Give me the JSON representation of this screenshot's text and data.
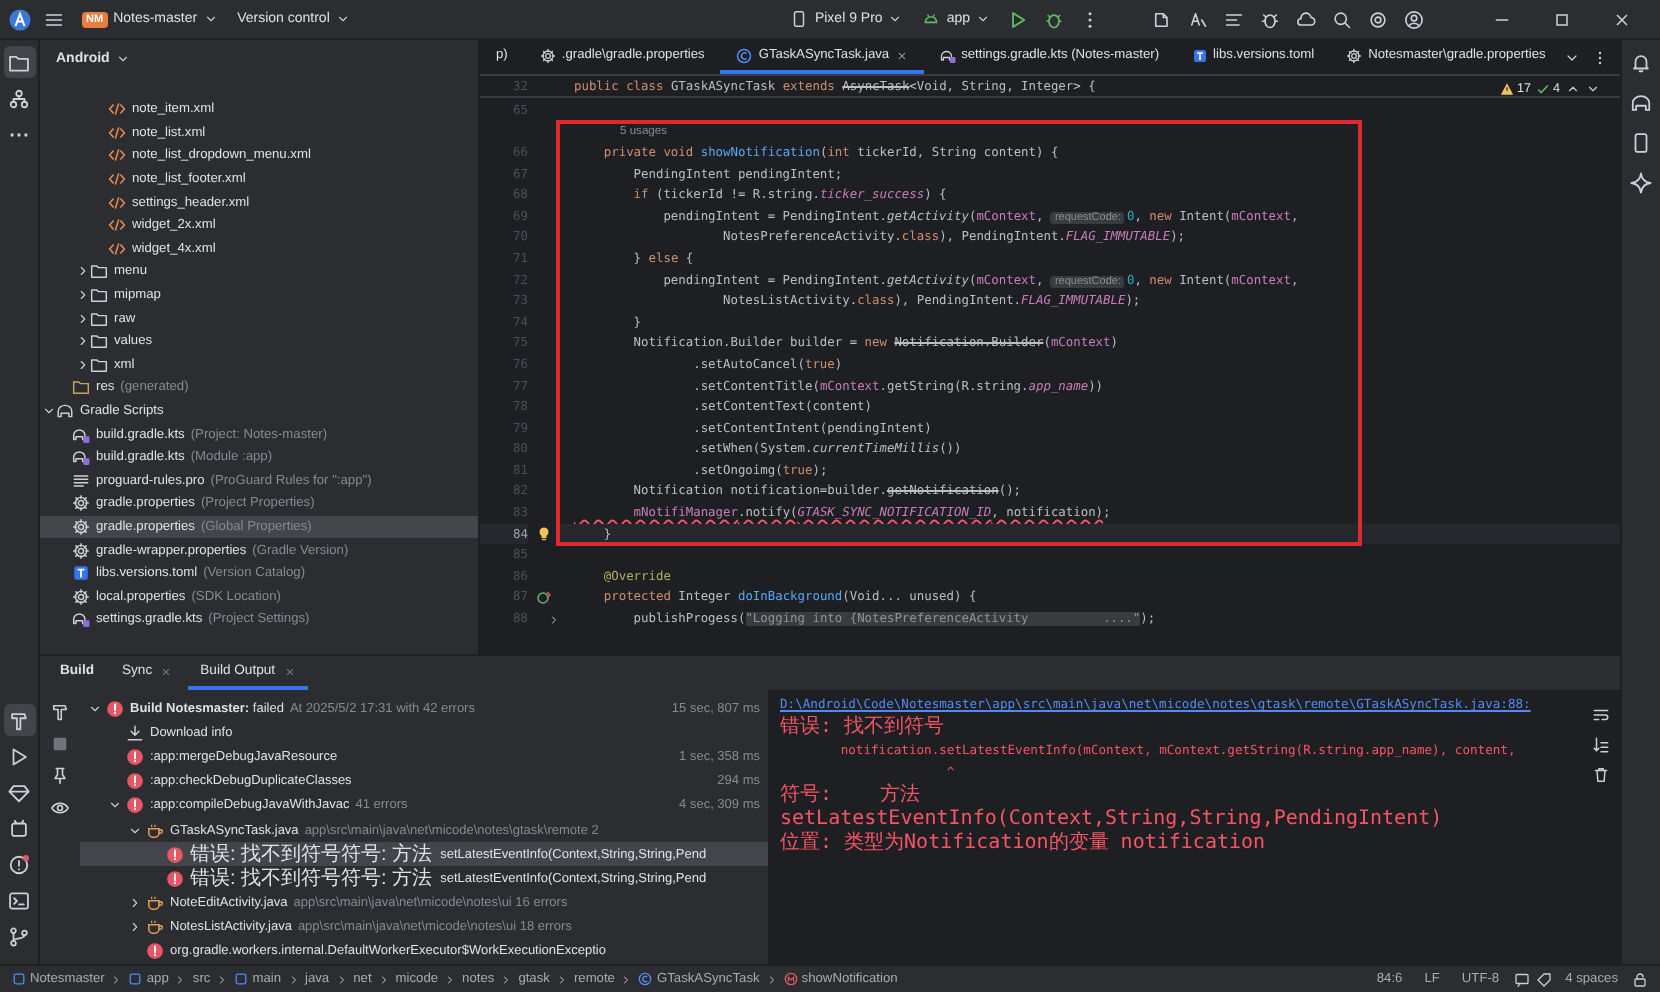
{
  "title_bar": {
    "project_badge": "NM",
    "project": "Notes-master",
    "vcs": "Version control",
    "device": "Pixel 9 Pro",
    "run_config": "app"
  },
  "tool_strip": [
    {
      "kind": "project",
      "selected": true
    },
    {
      "kind": "structure",
      "selected": false
    },
    {
      "kind": "more",
      "selected": false
    },
    {
      "kind": "build",
      "selected": true
    },
    {
      "kind": "run",
      "selected": false
    },
    {
      "kind": "gem",
      "selected": false
    },
    {
      "kind": "device",
      "selected": false
    },
    {
      "kind": "problems",
      "selected": false
    },
    {
      "kind": "terminal",
      "selected": false
    },
    {
      "kind": "git",
      "selected": false
    }
  ],
  "project_panel": {
    "view": "Android",
    "tree": [
      {
        "children": [
          {
            "children": [
              {
                "children": [
                  {
                    "label": "note_item.xml",
                    "kind": "xml",
                    "selected": false
                  },
                  {
                    "label": "note_list.xml",
                    "kind": "xml",
                    "selected": false
                  },
                  {
                    "label": "note_list_dropdown_menu.xml",
                    "kind": "xml",
                    "selected": false
                  },
                  {
                    "label": "note_list_footer.xml",
                    "kind": "xml",
                    "selected": false
                  },
                  {
                    "label": "settings_header.xml",
                    "kind": "xml",
                    "selected": false
                  },
                  {
                    "label": "widget_2x.xml",
                    "kind": "xml",
                    "selected": false
                  },
                  {
                    "label": "widget_4x.xml",
                    "kind": "xml",
                    "selected": false
                  }
                ]
              },
              {
                "label": "menu",
                "kind": "folder",
                "expanded": false,
                "selected": false
              },
              {
                "label": "mipmap",
                "kind": "folder",
                "expanded": false,
                "selected": false
              },
              {
                "label": "raw",
                "kind": "folder",
                "expanded": false,
                "selected": false
              },
              {
                "label": "values",
                "kind": "folder",
                "expanded": false,
                "selected": false
              },
              {
                "label": "xml",
                "kind": "folder",
                "expanded": false,
                "selected": false
              }
            ]
          },
          {
            "label": "res",
            "detail": "(generated)",
            "kind": "res",
            "selected": false
          }
        ]
      },
      {
        "label": "Gradle Scripts",
        "kind": "gradle_folder",
        "expanded": true,
        "selected": false,
        "children": [
          {
            "label": "build.gradle.kts",
            "detail": "(Project: Notes-master)",
            "kind": "gradle",
            "selected": false
          },
          {
            "label": "build.gradle.kts",
            "detail": "(Module :app)",
            "kind": "gradle",
            "selected": false
          },
          {
            "label": "proguard-rules.pro",
            "detail": "(ProGuard Rules for \":app\")",
            "kind": "text",
            "selected": false
          },
          {
            "label": "gradle.properties",
            "detail": "(Project Properties)",
            "kind": "properties",
            "selected": false
          },
          {
            "label": "gradle.properties",
            "detail": "(Global Properties)",
            "kind": "properties",
            "selected": true
          },
          {
            "label": "gradle-wrapper.properties",
            "detail": "(Gradle Version)",
            "kind": "properties",
            "selected": false
          },
          {
            "label": "libs.versions.toml",
            "detail": "(Version Catalog)",
            "kind": "toml",
            "selected": false
          },
          {
            "label": "local.properties",
            "detail": "(SDK Location)",
            "kind": "properties",
            "selected": false
          },
          {
            "label": "settings.gradle.kts",
            "detail": "(Project Settings)",
            "kind": "gradle",
            "selected": false
          }
        ]
      }
    ]
  },
  "editor_tabs": [
    {
      "label": "p)",
      "selected": false
    },
    {
      "label": ".gradle\\gradle.properties",
      "kind": "properties",
      "selected": false
    },
    {
      "label": "GTaskASyncTask.java",
      "kind": "class",
      "selected": true
    },
    {
      "label": "settings.gradle.kts (Notes-master)",
      "kind": "gradle",
      "selected": false
    },
    {
      "label": "libs.versions.toml",
      "kind": "toml",
      "selected": false
    },
    {
      "label": "Notesmaster\\gradle.properties",
      "kind": "properties",
      "selected": false
    }
  ],
  "inspections": {
    "warnings": "17",
    "passed": "4"
  },
  "code": {
    "sticky_line": {
      "number": "32",
      "tokens": [
        {
          "text": "public class ",
          "kind": "kw"
        },
        {
          "text": "GTaskASyncTask ",
          "kind": "plain"
        },
        {
          "text": "extends ",
          "kind": "kw"
        },
        {
          "text": "AsyncTask",
          "kind": "deprecated"
        },
        {
          "text": "<Void, String, Integer> {",
          "kind": "plain"
        }
      ]
    },
    "lines_before": [
      {
        "number": "65",
        "current": false
      }
    ],
    "framed_lines": [
      {
        "kind": "usages",
        "text": "5 usages",
        "current": false
      },
      {
        "number": "66",
        "current": false,
        "tokens": [
          {
            "text": "    private void ",
            "kind": "kw"
          },
          {
            "text": "showNotification",
            "kind": "fn"
          },
          {
            "text": "(",
            "kind": "plain"
          },
          {
            "text": "int ",
            "kind": "kw"
          },
          {
            "text": "tickerId, String content) {",
            "kind": "plain"
          }
        ]
      },
      {
        "number": "67",
        "current": false,
        "tokens": [
          {
            "text": "        PendingIntent pendingIntent;",
            "kind": "plain"
          }
        ]
      },
      {
        "number": "68",
        "current": false,
        "tokens": [
          {
            "text": "        if ",
            "kind": "kw"
          },
          {
            "text": "(tickerId != R.string.",
            "kind": "plain"
          },
          {
            "text": "ticker_success",
            "kind": "static"
          },
          {
            "text": ") {",
            "kind": "plain"
          }
        ]
      },
      {
        "number": "69",
        "current": false,
        "tokens": [
          {
            "text": "            pendingIntent = PendingIntent.",
            "kind": "plain"
          },
          {
            "text": "getActivity",
            "kind": "static_call"
          },
          {
            "text": "(",
            "kind": "plain"
          },
          {
            "text": "mContext",
            "kind": "field"
          },
          {
            "text": ", ",
            "kind": "plain"
          },
          {
            "text": "requestCode:",
            "kind": "hint"
          },
          {
            "text": "0",
            "kind": "num"
          },
          {
            "text": ", ",
            "kind": "plain"
          },
          {
            "text": "new ",
            "kind": "kw"
          },
          {
            "text": "Intent(",
            "kind": "plain"
          },
          {
            "text": "mContext",
            "kind": "field"
          },
          {
            "text": ",",
            "kind": "plain"
          }
        ]
      },
      {
        "number": "70",
        "current": false,
        "tokens": [
          {
            "text": "                    NotesPreferenceActivity.",
            "kind": "plain"
          },
          {
            "text": "class",
            "kind": "kw"
          },
          {
            "text": "), PendingIntent.",
            "kind": "plain"
          },
          {
            "text": "FLAG_IMMUTABLE",
            "kind": "static"
          },
          {
            "text": ");",
            "kind": "plain"
          }
        ]
      },
      {
        "number": "71",
        "current": false,
        "tokens": [
          {
            "text": "        } ",
            "kind": "plain"
          },
          {
            "text": "else ",
            "kind": "kw"
          },
          {
            "text": "{",
            "kind": "plain"
          }
        ]
      },
      {
        "number": "72",
        "current": false,
        "tokens": [
          {
            "text": "            pendingIntent = PendingIntent.",
            "kind": "plain"
          },
          {
            "text": "getActivity",
            "kind": "static_call"
          },
          {
            "text": "(",
            "kind": "plain"
          },
          {
            "text": "mContext",
            "kind": "field"
          },
          {
            "text": ", ",
            "kind": "plain"
          },
          {
            "text": "requestCode:",
            "kind": "hint"
          },
          {
            "text": "0",
            "kind": "num"
          },
          {
            "text": ", ",
            "kind": "plain"
          },
          {
            "text": "new ",
            "kind": "kw"
          },
          {
            "text": "Intent(",
            "kind": "plain"
          },
          {
            "text": "mContext",
            "kind": "field"
          },
          {
            "text": ",",
            "kind": "plain"
          }
        ]
      },
      {
        "number": "73",
        "current": false,
        "tokens": [
          {
            "text": "                    NotesListActivity.",
            "kind": "plain"
          },
          {
            "text": "class",
            "kind": "kw"
          },
          {
            "text": "), PendingIntent.",
            "kind": "plain"
          },
          {
            "text": "FLAG_IMMUTABLE",
            "kind": "static"
          },
          {
            "text": ");",
            "kind": "plain"
          }
        ]
      },
      {
        "number": "74",
        "current": false,
        "tokens": [
          {
            "text": "        }",
            "kind": "plain"
          }
        ]
      },
      {
        "number": "75",
        "current": false,
        "tokens": [
          {
            "text": "        Notification.Builder builder = ",
            "kind": "plain"
          },
          {
            "text": "new ",
            "kind": "kw"
          },
          {
            "text": "Notification.Builder",
            "kind": "deprecated"
          },
          {
            "text": "(",
            "kind": "plain"
          },
          {
            "text": "mContext",
            "kind": "field"
          },
          {
            "text": ")",
            "kind": "plain"
          }
        ]
      },
      {
        "number": "76",
        "current": false,
        "tokens": [
          {
            "text": "                .setAutoCancel(",
            "kind": "plain"
          },
          {
            "text": "true",
            "kind": "kw"
          },
          {
            "text": ")",
            "kind": "plain"
          }
        ]
      },
      {
        "number": "77",
        "current": false,
        "tokens": [
          {
            "text": "                .setContentTitle(",
            "kind": "plain"
          },
          {
            "text": "mContext",
            "kind": "field"
          },
          {
            "text": ".getString(R.string.",
            "kind": "plain"
          },
          {
            "text": "app_name",
            "kind": "static"
          },
          {
            "text": "))",
            "kind": "plain"
          }
        ]
      },
      {
        "number": "78",
        "current": false,
        "tokens": [
          {
            "text": "                .setContentText(content)",
            "kind": "plain"
          }
        ]
      },
      {
        "number": "79",
        "current": false,
        "tokens": [
          {
            "text": "                .setContentIntent(pendingIntent)",
            "kind": "plain"
          }
        ]
      },
      {
        "number": "80",
        "current": false,
        "tokens": [
          {
            "text": "                .setWhen(System.",
            "kind": "plain"
          },
          {
            "text": "currentTimeMillis",
            "kind": "static_call"
          },
          {
            "text": "())",
            "kind": "plain"
          }
        ]
      },
      {
        "number": "81",
        "current": false,
        "tokens": [
          {
            "text": "                .setOngoimg(",
            "kind": "plain"
          },
          {
            "text": "true",
            "kind": "kw"
          },
          {
            "text": ");",
            "kind": "plain"
          }
        ]
      },
      {
        "number": "82",
        "current": false,
        "tokens": [
          {
            "text": "        Notification notification=builder.",
            "kind": "plain"
          },
          {
            "text": "getNotification",
            "kind": "deprecated"
          },
          {
            "text": "();",
            "kind": "plain"
          }
        ]
      },
      {
        "number": "83",
        "current": false,
        "tokens": [
          {
            "text": "        mNotifiManager",
            "kind": "error_field"
          },
          {
            "text": ".notify(",
            "kind": "error"
          },
          {
            "text": "GTASK_SYNC_NOTIFICATION_ID",
            "kind": "error_static"
          },
          {
            "text": ", notification)",
            "kind": "error"
          },
          {
            "text": ";",
            "kind": "plain"
          }
        ]
      },
      {
        "number": "84",
        "current": true,
        "gutter": {
          "kind": "bulb"
        },
        "tokens": [
          {
            "text": "    }",
            "kind": "plain"
          }
        ]
      }
    ],
    "lines_after": [
      {
        "number": "85",
        "current": false
      },
      {
        "number": "86",
        "current": false,
        "tokens": [
          {
            "text": "    @Override",
            "kind": "anno"
          }
        ]
      },
      {
        "number": "87",
        "current": false,
        "gutter": {
          "kind": "override"
        },
        "tokens": [
          {
            "text": "    protected ",
            "kind": "kw"
          },
          {
            "text": "Integer ",
            "kind": "plain"
          },
          {
            "text": "doInBackground",
            "kind": "fn"
          },
          {
            "text": "(Void... unused) {",
            "kind": "plain"
          }
        ]
      },
      {
        "number": "88",
        "current": false,
        "gutter": {
          "kind": "fold"
        },
        "tokens": [
          {
            "text": "        publishProgess(",
            "kind": "plain"
          },
          {
            "text": "\"Logging into {NotesPreferenceActivity          ....\"",
            "kind": "str"
          },
          {
            "text": ");",
            "kind": "plain"
          }
        ]
      }
    ]
  },
  "build_panel": {
    "tabs": [
      {
        "label": "Build",
        "kind": "title",
        "selected": false
      },
      {
        "label": "Sync",
        "kind": "tab",
        "selected": false
      },
      {
        "label": "Build Output",
        "kind": "tab",
        "selected": true
      }
    ],
    "tree": [
      {
        "kind": "error",
        "label": "**Build Notesmaster:** failed",
        "detail": "At 2025/5/2 17:31 with 42 errors",
        "time": "15 sec, 807 ms",
        "expanded": true,
        "selected": false,
        "children": [
          {
            "kind": "download",
            "label": "Download info",
            "selected": false
          },
          {
            "kind": "error",
            "label": ":app:mergeDebugJavaResource",
            "time": "1 sec, 358 ms",
            "selected": false
          },
          {
            "kind": "error",
            "label": ":app:checkDebugDuplicateClasses",
            "time": "294 ms",
            "selected": false
          },
          {
            "kind": "error",
            "label": ":app:compileDebugJavaWithJavac",
            "detail": "41 errors",
            "time": "4 sec, 309 ms",
            "expanded": true,
            "selected": false,
            "children": [
              {
                "kind": "java_file",
                "label": "GTaskASyncTask.java",
                "detail": "app\\src\\main\\java\\net\\micode\\notes\\gtask\\remote 2",
                "expanded": true,
                "selected": false,
                "children": [
                  {
                    "kind": "error_message",
                    "label": "错误: 找不到符号符号:   方法",
                    "detail": "setLatestEventInfo(Context,String,String,Pend",
                    "selected": true
                  },
                  {
                    "kind": "error_message",
                    "label": "错误: 找不到符号符号:   方法",
                    "detail": "setLatestEventInfo(Context,String,String,Pend",
                    "selected": false
                  }
                ]
              },
              {
                "kind": "java_file",
                "label": "NoteEditActivity.java",
                "detail": "app\\src\\main\\java\\net\\micode\\notes\\ui 16 errors",
                "expanded": false,
                "selected": false
              },
              {
                "kind": "java_file",
                "label": "NotesListActivity.java",
                "detail": "app\\src\\main\\java\\net\\micode\\notes\\ui 18 errors",
                "expanded": false,
                "selected": false
              },
              {
                "kind": "error",
                "label": "org.gradle.workers.internal.DefaultWorkerExecutor$WorkExecutionExceptio",
                "selected": false
              }
            ]
          }
        ]
      }
    ],
    "console": [
      {
        "kind": "location",
        "link": "D:\\Android\\Code\\Notesmaster\\app\\src\\main\\java\\net\\micode\\notes\\gtask\\remote\\GTaskASyncTask.java:88:",
        "text": "错误: 找不到符号"
      },
      {
        "kind": "code",
        "text": "        notification.setLatestEventInfo(mContext, mContext.getString(R.string.app_name), content,"
      },
      {
        "kind": "code",
        "text": "                      ^"
      },
      {
        "kind": "note",
        "text": "符号:    方法 setLatestEventInfo(Context,String,String,PendingIntent)"
      },
      {
        "kind": "note",
        "text": "位置: 类型为Notification的变量 notification"
      }
    ]
  },
  "status_bar": {
    "breadcrumbs": [
      {
        "label": "Notesmaster",
        "kind": "module"
      },
      {
        "label": "app",
        "kind": "module"
      },
      {
        "label": "src",
        "kind": "package"
      },
      {
        "label": "main",
        "kind": "module"
      },
      {
        "label": "java",
        "kind": "package"
      },
      {
        "label": "net",
        "kind": "package"
      },
      {
        "label": "micode",
        "kind": "package"
      },
      {
        "label": "notes",
        "kind": "package"
      },
      {
        "label": "gtask",
        "kind": "package"
      },
      {
        "label": "remote",
        "kind": "package"
      },
      {
        "label": "GTaskASyncTask",
        "kind": "class"
      },
      {
        "label": "showNotification",
        "kind": "method"
      }
    ],
    "position": "84:6",
    "line_separator": "LF",
    "encoding": "UTF-8",
    "indent": "4 spaces"
  }
}
